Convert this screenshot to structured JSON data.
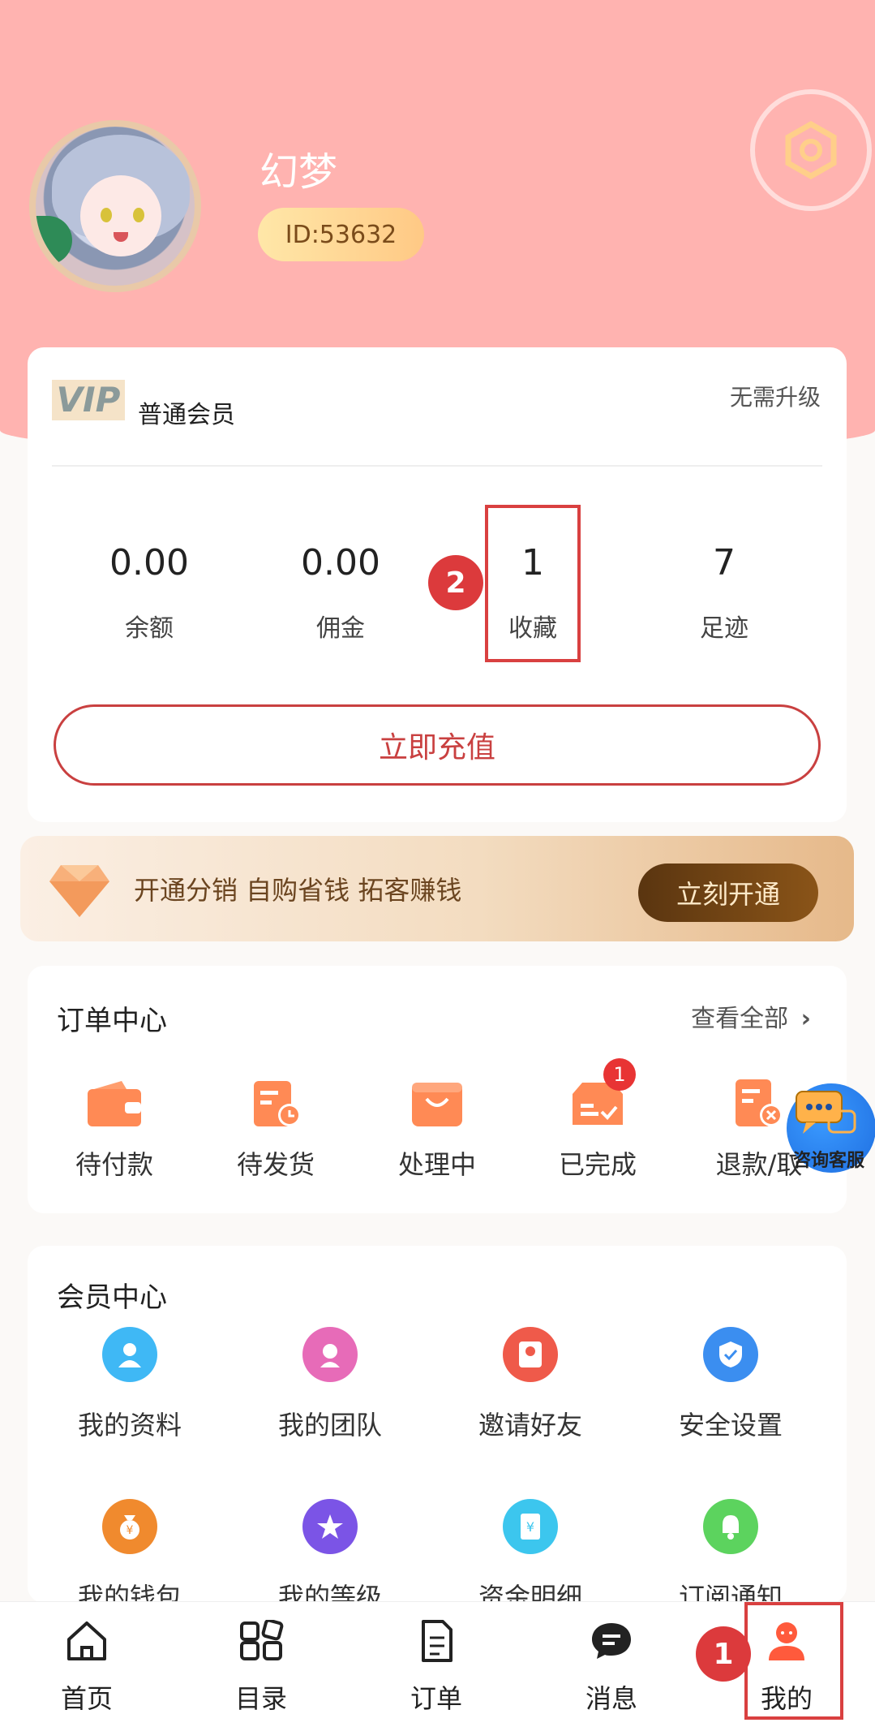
{
  "profile": {
    "username": "幻梦",
    "id_text": "ID:53632"
  },
  "vip": {
    "badge": "VIP",
    "level": "普通会员",
    "upgrade_text": "无需升级"
  },
  "stats": [
    {
      "value": "0.00",
      "label": "余额"
    },
    {
      "value": "0.00",
      "label": "佣金"
    },
    {
      "value": "1",
      "label": "收藏"
    },
    {
      "value": "7",
      "label": "足迹"
    }
  ],
  "annotations": {
    "step1": "1",
    "step2": "2"
  },
  "recharge_label": "立即充值",
  "distribution_banner": {
    "text": "开通分销 自购省钱 拓客赚钱",
    "button": "立刻开通"
  },
  "orders": {
    "title": "订单中心",
    "view_all": "查看全部",
    "items": [
      {
        "label": "待付款",
        "icon": "wallet-icon"
      },
      {
        "label": "待发货",
        "icon": "clock-doc-icon"
      },
      {
        "label": "处理中",
        "icon": "bag-icon"
      },
      {
        "label": "已完成",
        "icon": "check-box-icon",
        "badge": "1"
      },
      {
        "label": "退款/取",
        "icon": "refund-icon"
      }
    ]
  },
  "customer_service": "咨询客服",
  "member": {
    "title": "会员中心",
    "items": [
      {
        "label": "我的资料",
        "color": "#3fb8f5"
      },
      {
        "label": "我的团队",
        "color": "#e76bb8"
      },
      {
        "label": "邀请好友",
        "color": "#ef5a4a"
      },
      {
        "label": "安全设置",
        "color": "#3b8ef0"
      },
      {
        "label": "我的钱包",
        "color": "#f08a2e"
      },
      {
        "label": "我的等级",
        "color": "#7b54e6"
      },
      {
        "label": "资金明细",
        "color": "#3cc6ee"
      },
      {
        "label": "订阅通知",
        "color": "#5cd35e"
      }
    ]
  },
  "tabs": [
    {
      "label": "首页",
      "icon": "home-icon"
    },
    {
      "label": "目录",
      "icon": "grid-icon"
    },
    {
      "label": "订单",
      "icon": "document-icon"
    },
    {
      "label": "消息",
      "icon": "chat-icon"
    },
    {
      "label": "我的",
      "icon": "person-icon"
    }
  ],
  "colors": {
    "header": "#ffb3b0",
    "accent": "#c94040",
    "orange": "#ff8a55"
  }
}
